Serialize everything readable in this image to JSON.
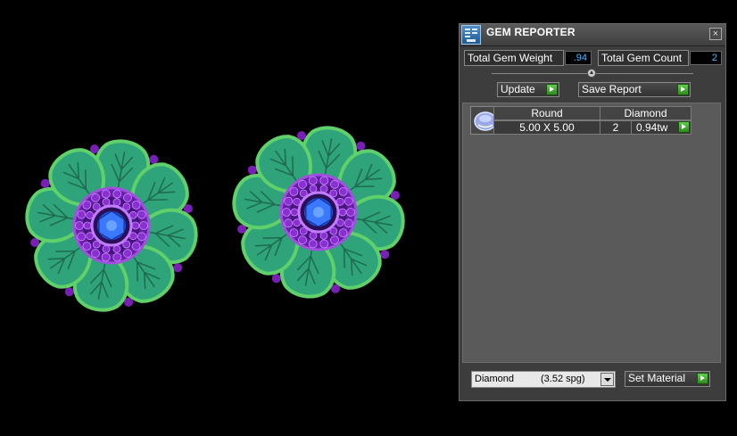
{
  "window": {
    "title": "GEM REPORTER",
    "close_label": "×"
  },
  "summary": {
    "weight_label": "Total Gem Weight",
    "weight_value": ".94",
    "count_label": "Total Gem Count",
    "count_value": "2"
  },
  "toolbar": {
    "update_label": "Update",
    "save_report_label": "Save Report"
  },
  "gem_table": {
    "headers": [
      "Round",
      "Diamond"
    ],
    "rows": [
      {
        "size": "5.00 X 5.00",
        "count": "2",
        "weight": "0.94tw"
      }
    ]
  },
  "material": {
    "selected_name": "Diamond",
    "selected_density": "(3.52 spg)",
    "set_material_label": "Set Material"
  },
  "icons": {
    "app": "gem-reporter-app-icon",
    "close": "close-icon",
    "go": "green-arrow-icon",
    "thumb": "round-gem-icon",
    "dropdown": "chevron-down-icon"
  },
  "colors": {
    "panel_bg": "#3d3d3d",
    "list_bg": "#5a5a5a",
    "value_text": "#4fb4ff",
    "go_button": "#3cae2c",
    "petal_green": "#2fa37a",
    "petal_rim": "#5fd06a",
    "setting_purple": "#7a1fb5",
    "center_stone": "#1f4fd8"
  }
}
